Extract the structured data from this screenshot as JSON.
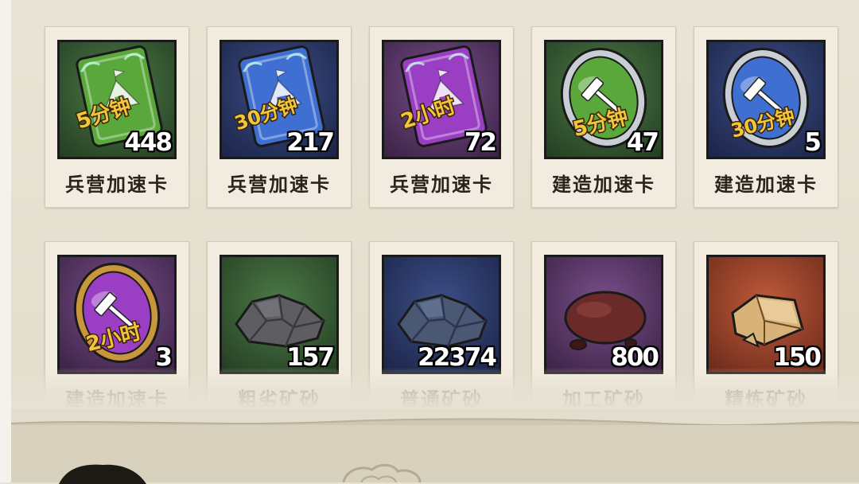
{
  "items": [
    {
      "name": "兵营加速卡",
      "qty": "448",
      "icon": "barracks-speedup-card-icon",
      "duration": "5分钟",
      "tier": "green",
      "bg": [
        "#4c7a46",
        "#243d22"
      ]
    },
    {
      "name": "兵营加速卡",
      "qty": "217",
      "icon": "barracks-speedup-card-icon",
      "duration": "30分钟",
      "tier": "blue",
      "bg": [
        "#3d4f88",
        "#1b2448"
      ]
    },
    {
      "name": "兵营加速卡",
      "qty": "72",
      "icon": "barracks-speedup-card-icon",
      "duration": "2小时",
      "tier": "purple",
      "bg": [
        "#7a4f8c",
        "#3a2244"
      ]
    },
    {
      "name": "建造加速卡",
      "qty": "47",
      "icon": "construction-speedup-medal-icon",
      "duration": "5分钟",
      "tier": "green",
      "bg": [
        "#4c7a46",
        "#243d22"
      ]
    },
    {
      "name": "建造加速卡",
      "qty": "5",
      "icon": "construction-speedup-medal-icon",
      "duration": "30分钟",
      "tier": "blue",
      "bg": [
        "#3d4f88",
        "#1b2448"
      ]
    },
    {
      "name": "建造加速卡",
      "qty": "3",
      "icon": "construction-speedup-medal-icon",
      "duration": "2小时",
      "tier": "purple",
      "bg": [
        "#7a4f8c",
        "#3a2244"
      ]
    },
    {
      "name": "粗劣矿砂",
      "qty": "157",
      "icon": "coarse-ore-icon",
      "duration": "",
      "tier": "green",
      "bg": [
        "#4c7a46",
        "#243d22"
      ]
    },
    {
      "name": "普通矿砂",
      "qty": "22374",
      "icon": "common-ore-icon",
      "duration": "",
      "tier": "blue",
      "bg": [
        "#3d4f88",
        "#1b2448"
      ]
    },
    {
      "name": "加工矿砂",
      "qty": "800",
      "icon": "processed-ore-icon",
      "duration": "",
      "tier": "purple",
      "bg": [
        "#7a4f8c",
        "#3a2244"
      ]
    },
    {
      "name": "精炼矿砂",
      "qty": "150",
      "icon": "refined-ore-icon",
      "duration": "",
      "tier": "orange",
      "bg": [
        "#c05a3a",
        "#6a2a1a"
      ]
    }
  ],
  "colors": {
    "green": "#5aa83c",
    "blue": "#3f6fd0",
    "purple": "#9a3fc4",
    "orange": "#c9a25a",
    "gold": "#f2c53a"
  }
}
